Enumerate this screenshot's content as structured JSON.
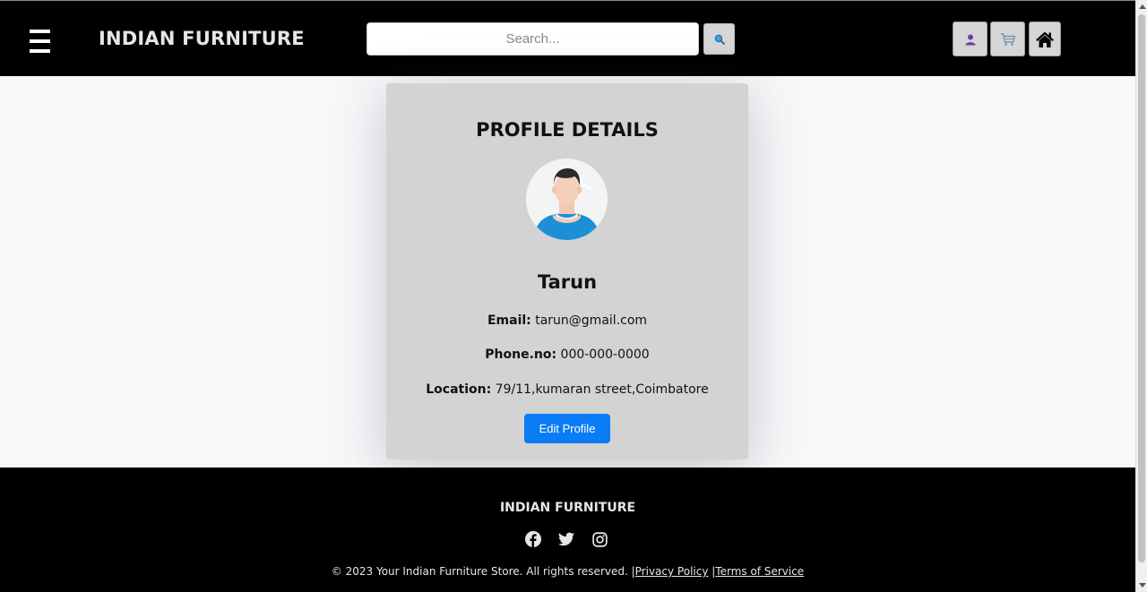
{
  "header": {
    "brand": "INDIAN FURNITURE",
    "search_placeholder": "Search..."
  },
  "profile": {
    "title": "PROFILE DETAILS",
    "name": "Tarun",
    "email_label": "Email:",
    "email": "tarun@gmail.com",
    "phone_label": "Phone.no:",
    "phone": "000-000-0000",
    "location_label": "Location:",
    "location": "79/11,kumaran street,Coimbatore",
    "edit_button": "Edit Profile"
  },
  "footer": {
    "brand": "INDIAN FURNITURE",
    "copyright": "© 2023 Your Indian Furniture Store. All rights reserved. |",
    "privacy": "Privacy Policy",
    "separator": " |",
    "terms": "Terms of Service",
    "socials": [
      "facebook-icon",
      "twitter-icon",
      "instagram-icon"
    ]
  },
  "colors": {
    "header_bg": "#000000",
    "card_bg": "#d3d3d3",
    "button_blue": "#0a7cf5",
    "page_bg": "#f8f8fa"
  }
}
